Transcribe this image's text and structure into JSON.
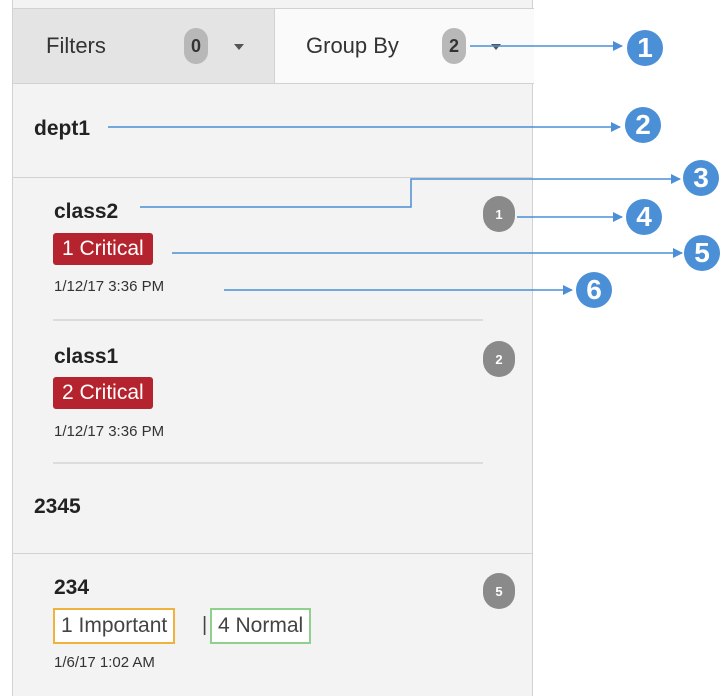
{
  "toolbar": {
    "filters": {
      "label": "Filters",
      "count": "0"
    },
    "group_by": {
      "label": "Group By",
      "count": "2"
    }
  },
  "dept": {
    "label": "dept1"
  },
  "items": [
    {
      "title": "class2",
      "count": "1",
      "badge": "1 Critical",
      "timestamp": "1/12/17 3:36 PM"
    },
    {
      "title": "class1",
      "count": "2",
      "badge": "2 Critical",
      "timestamp": "1/12/17 3:36 PM"
    }
  ],
  "group2": {
    "label": "2345"
  },
  "item3": {
    "title": "234",
    "count": "5",
    "important": "1 Important",
    "separator": "|",
    "normal": "4 Normal",
    "timestamp": "1/6/17 1:02 AM"
  },
  "callouts": [
    "1",
    "2",
    "3",
    "4",
    "5",
    "6"
  ],
  "colors": {
    "callout": "#4b8fd6",
    "critical": "#b5242e",
    "important_border": "#f0b23c",
    "normal_border": "#8fd08f"
  }
}
